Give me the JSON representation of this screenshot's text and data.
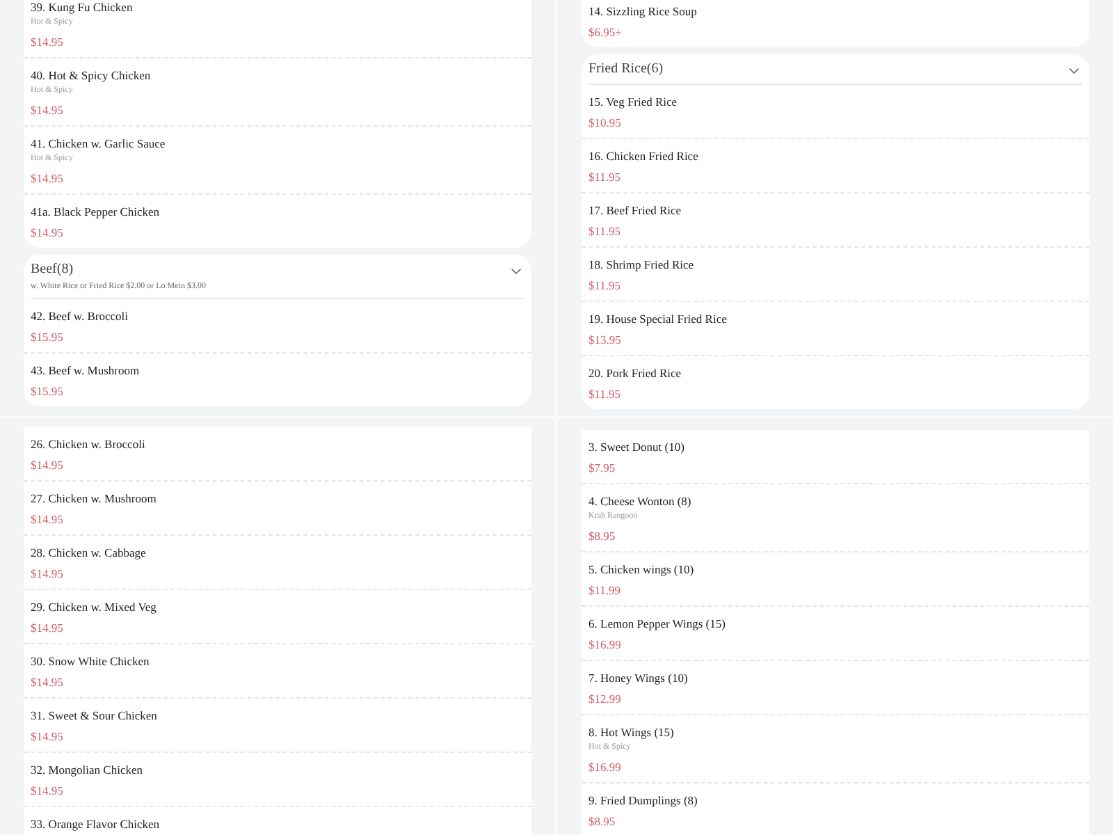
{
  "panels": [
    {
      "cards": [
        {
          "items": [
            {
              "name": "39. Kung Fu Chicken",
              "desc": "Hot & Spicy",
              "price": "$14.95"
            },
            {
              "name": "40. Hot & Spicy Chicken",
              "desc": "Hot & Spicy",
              "price": "$14.95"
            },
            {
              "name": "41. Chicken w. Garlic Sauce",
              "desc": "Hot & Spicy",
              "price": "$14.95"
            },
            {
              "name": "41a. Black Pepper Chicken",
              "price": "$14.95"
            }
          ]
        },
        {
          "title": "Beef(8)",
          "note": "w. White Rice or Fried Rice $2.00 or Lo Mein $3.00",
          "items": [
            {
              "name": "42. Beef w. Broccoli",
              "price": "$15.95"
            },
            {
              "name": "43. Beef w. Mushroom",
              "price": "$15.95"
            }
          ]
        }
      ]
    },
    {
      "cards": [
        {
          "items": [
            {
              "name": "14. Sizzling Rice Soup",
              "price": "$6.95+"
            }
          ]
        },
        {
          "title": "Fried Rice(6)",
          "items": [
            {
              "name": "15. Veg Fried Rice",
              "price": "$10.95"
            },
            {
              "name": "16. Chicken Fried Rice",
              "price": "$11.95"
            },
            {
              "name": "17. Beef Fried Rice",
              "price": "$11.95"
            },
            {
              "name": "18. Shrimp Fried Rice",
              "price": "$11.95"
            },
            {
              "name": "19. House Special Fried Rice",
              "price": "$13.95"
            },
            {
              "name": "20. Pork Fried Rice",
              "price": "$11.95"
            }
          ]
        }
      ]
    },
    {
      "cards": [
        {
          "items": [
            {
              "name": "26. Chicken w. Broccoli",
              "price": "$14.95"
            },
            {
              "name": "27. Chicken w. Mushroom",
              "price": "$14.95"
            },
            {
              "name": "28. Chicken w. Cabbage",
              "price": "$14.95"
            },
            {
              "name": "29. Chicken w. Mixed Veg",
              "price": "$14.95"
            },
            {
              "name": "30. Snow White Chicken",
              "price": "$14.95"
            },
            {
              "name": "31. Sweet & Sour Chicken",
              "price": "$14.95"
            },
            {
              "name": "32. Mongolian Chicken",
              "price": "$14.95"
            },
            {
              "name": "33. Orange Flavor Chicken"
            }
          ]
        }
      ]
    },
    {
      "cards": [
        {
          "items": [
            {
              "name": "3. Sweet Donut (10)",
              "price": "$7.95"
            },
            {
              "name": "4. Cheese Wonton (8)",
              "desc": "Krab Rangoon",
              "price": "$8.95"
            },
            {
              "name": "5. Chicken wings (10)",
              "price": "$11.99"
            },
            {
              "name": "6. Lemon Pepper Wings (15)",
              "price": "$16.99"
            },
            {
              "name": "7. Honey Wings (10)",
              "price": "$12.99"
            },
            {
              "name": "8. Hot Wings (15)",
              "desc": "Hot & Spicy",
              "price": "$16.99"
            },
            {
              "name": "9. Fried Dumplings (8)",
              "price": "$8.95"
            }
          ]
        }
      ]
    }
  ]
}
